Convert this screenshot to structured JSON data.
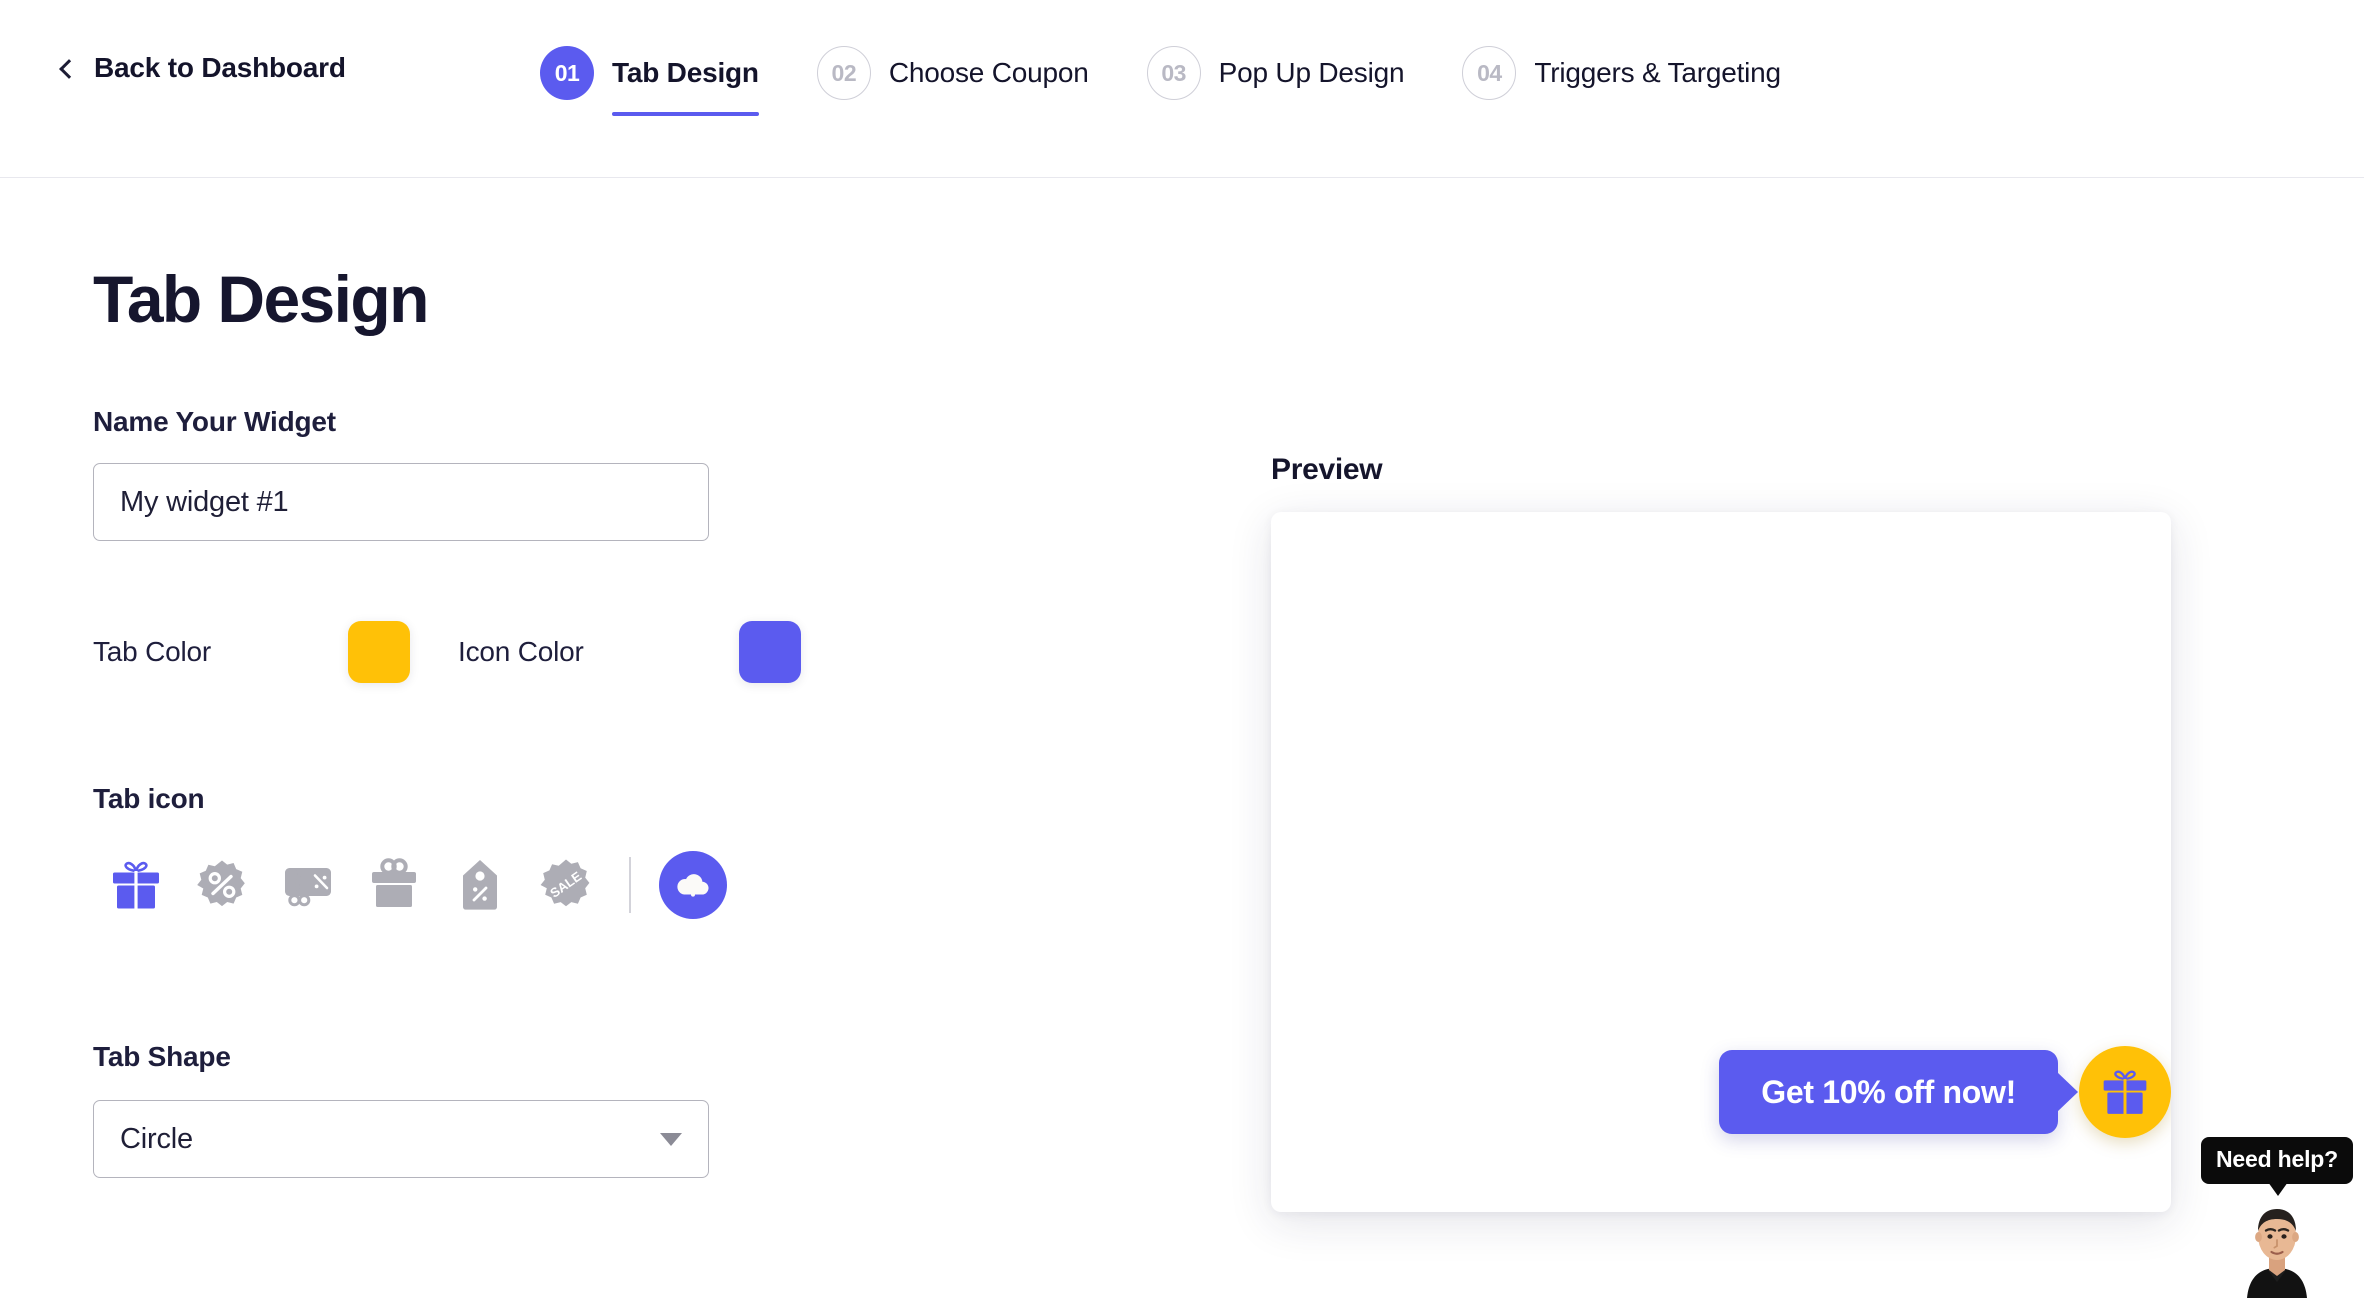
{
  "header": {
    "back_label": "Back to Dashboard",
    "back_icon": "chevron-left-icon",
    "steps": [
      {
        "num": "01",
        "label": "Tab Design",
        "active": true
      },
      {
        "num": "02",
        "label": "Choose Coupon",
        "active": false
      },
      {
        "num": "03",
        "label": "Pop Up Design",
        "active": false
      },
      {
        "num": "04",
        "label": "Triggers & Targeting",
        "active": false
      }
    ]
  },
  "form": {
    "title": "Tab Design",
    "name_label": "Name Your Widget",
    "name_value": "My widget #1",
    "name_placeholder": "My widget #1",
    "tab_color_label": "Tab Color",
    "tab_color_value": "#FFC107",
    "icon_color_label": "Icon Color",
    "icon_color_value": "#5B5BEF",
    "tab_icon_label": "Tab icon",
    "icons": [
      {
        "name": "gift-ribbon-icon",
        "selected": true
      },
      {
        "name": "percent-badge-icon",
        "selected": false
      },
      {
        "name": "coupon-scissors-icon",
        "selected": false
      },
      {
        "name": "gift-box-icon",
        "selected": false
      },
      {
        "name": "price-tag-percent-icon",
        "selected": false
      },
      {
        "name": "sale-badge-icon",
        "selected": false
      }
    ],
    "upload_icon": "cloud-upload-icon",
    "shape_label": "Tab Shape",
    "shape_value": "Circle",
    "shape_options": [
      "Circle"
    ],
    "dropdown_icon": "chevron-down-icon"
  },
  "preview": {
    "label": "Preview",
    "bubble_text": "Get 10% off now!",
    "tab_icon": "gift-ribbon-icon",
    "tab_bg_color": "#FFC107",
    "bubble_bg_color": "#5B5BEF"
  },
  "help": {
    "tooltip": "Need help?",
    "avatar": "support-agent-avatar"
  }
}
